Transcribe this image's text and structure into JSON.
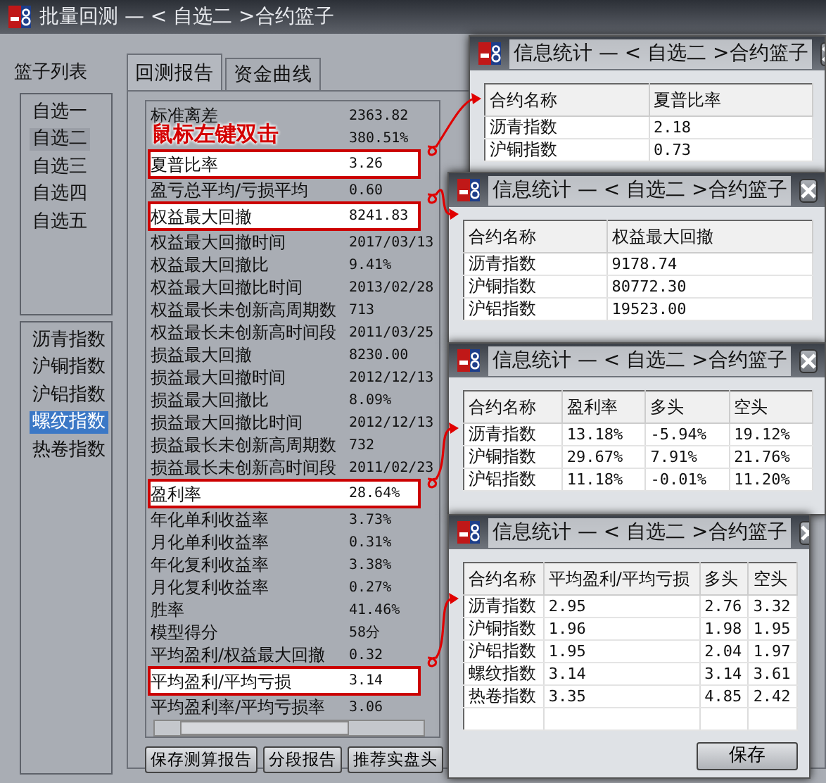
{
  "main_window": {
    "title": "批量回测 — < 自选二 >合约篮子",
    "basket_label": "篮子列表",
    "baskets": [
      {
        "label": "自选一",
        "selected": false
      },
      {
        "label": "自选二",
        "selected": true
      },
      {
        "label": "自选三",
        "selected": false
      },
      {
        "label": "自选四",
        "selected": false
      },
      {
        "label": "自选五",
        "selected": false
      }
    ],
    "contracts": [
      {
        "label": "沥青指数",
        "selected": false
      },
      {
        "label": "沪铜指数",
        "selected": false
      },
      {
        "label": "沪铝指数",
        "selected": false
      },
      {
        "label": "螺纹指数",
        "selected": true
      },
      {
        "label": "热卷指数",
        "selected": false
      }
    ],
    "tabs": [
      {
        "label": "回测报告",
        "selected": true
      },
      {
        "label": "资金曲线",
        "selected": false
      }
    ],
    "annotation": "鼠标左键双击",
    "report_rows": [
      {
        "label": "标准离差",
        "value": "2363.82",
        "highlighted": false
      },
      {
        "value": "380.51%",
        "highlighted": false
      },
      {
        "label": "夏普比率",
        "value": "3.26",
        "highlighted": true
      },
      {
        "label": "盈亏总平均/亏损平均",
        "value": "0.60",
        "highlighted": false
      },
      {
        "label": "权益最大回撤",
        "value": "8241.83",
        "highlighted": true
      },
      {
        "label": "权益最大回撤时间",
        "value": "2017/03/13",
        "highlighted": false
      },
      {
        "label": "权益最大回撤比",
        "value": "9.41%",
        "highlighted": false
      },
      {
        "label": "权益最大回撤比时间",
        "value": "2013/02/28",
        "highlighted": false
      },
      {
        "label": "权益最长未创新高周期数",
        "value": "713",
        "highlighted": false
      },
      {
        "label": "权益最长未创新高时间段",
        "value": "2011/03/25",
        "highlighted": false
      },
      {
        "label": "损益最大回撤",
        "value": "8230.00",
        "highlighted": false
      },
      {
        "label": "损益最大回撤时间",
        "value": "2012/12/13",
        "highlighted": false
      },
      {
        "label": "损益最大回撤比",
        "value": "8.09%",
        "highlighted": false
      },
      {
        "label": "损益最大回撤比时间",
        "value": "2012/12/13",
        "highlighted": false
      },
      {
        "label": "损益最长未创新高周期数",
        "value": "732",
        "highlighted": false
      },
      {
        "label": "损益最长未创新高时间段",
        "value": "2011/02/23",
        "highlighted": false
      },
      {
        "label": "盈利率",
        "value": "28.64%",
        "highlighted": true
      },
      {
        "label": "年化单利收益率",
        "value": "3.73%",
        "highlighted": false
      },
      {
        "label": "月化单利收益率",
        "value": "0.31%",
        "highlighted": false
      },
      {
        "label": "年化复利收益率",
        "value": "3.38%",
        "highlighted": false
      },
      {
        "label": "月化复利收益率",
        "value": "0.27%",
        "highlighted": false
      },
      {
        "label": "胜率",
        "value": "41.46%",
        "highlighted": false
      },
      {
        "label": "模型得分",
        "value": "58分",
        "highlighted": false
      },
      {
        "label": "平均盈利/权益最大回撤",
        "value": "0.32",
        "highlighted": false
      },
      {
        "label": "平均盈利/平均亏损",
        "value": "3.14",
        "highlighted": true
      },
      {
        "label": "平均盈利率/平均亏损率",
        "value": "3.06",
        "highlighted": false
      }
    ],
    "buttons": [
      "保存测算报告",
      "分段报告",
      "推荐实盘头"
    ]
  },
  "stat_windows": [
    {
      "title": "信息统计 — < 自选二 >合约篮子",
      "columns": [
        "合约名称",
        "夏普比率"
      ],
      "rows": [
        [
          "沥青指数",
          "2.18"
        ],
        [
          "沪铜指数",
          "0.73"
        ]
      ]
    },
    {
      "title": "信息统计 — < 自选二 >合约篮子",
      "columns": [
        "合约名称",
        "权益最大回撤"
      ],
      "rows": [
        [
          "沥青指数",
          "9178.74"
        ],
        [
          "沪铜指数",
          "80772.30"
        ],
        [
          "沪铝指数",
          "19523.00"
        ]
      ]
    },
    {
      "title": "信息统计 — < 自选二 >合约篮子",
      "columns": [
        "合约名称",
        "盈利率",
        "多头",
        "空头"
      ],
      "rows": [
        [
          "沥青指数",
          "13.18%",
          "-5.94%",
          "19.12%"
        ],
        [
          "沪铜指数",
          "29.67%",
          "7.91%",
          "21.76%"
        ],
        [
          "沪铝指数",
          "11.18%",
          "-0.01%",
          "11.20%"
        ]
      ]
    },
    {
      "title": "信息统计 — < 自选二 >合约篮子",
      "columns": [
        "合约名称",
        "平均盈利/平均亏损",
        "多头",
        "空头"
      ],
      "rows": [
        [
          "沥青指数",
          "2.95",
          "2.76",
          "3.32"
        ],
        [
          "沪铜指数",
          "1.96",
          "1.98",
          "1.95"
        ],
        [
          "沪铝指数",
          "1.95",
          "2.04",
          "1.97"
        ],
        [
          "螺纹指数",
          "3.14",
          "3.14",
          "3.61"
        ],
        [
          "热卷指数",
          "3.35",
          "4.85",
          "2.42"
        ]
      ],
      "buttons": [
        "保存"
      ]
    }
  ]
}
